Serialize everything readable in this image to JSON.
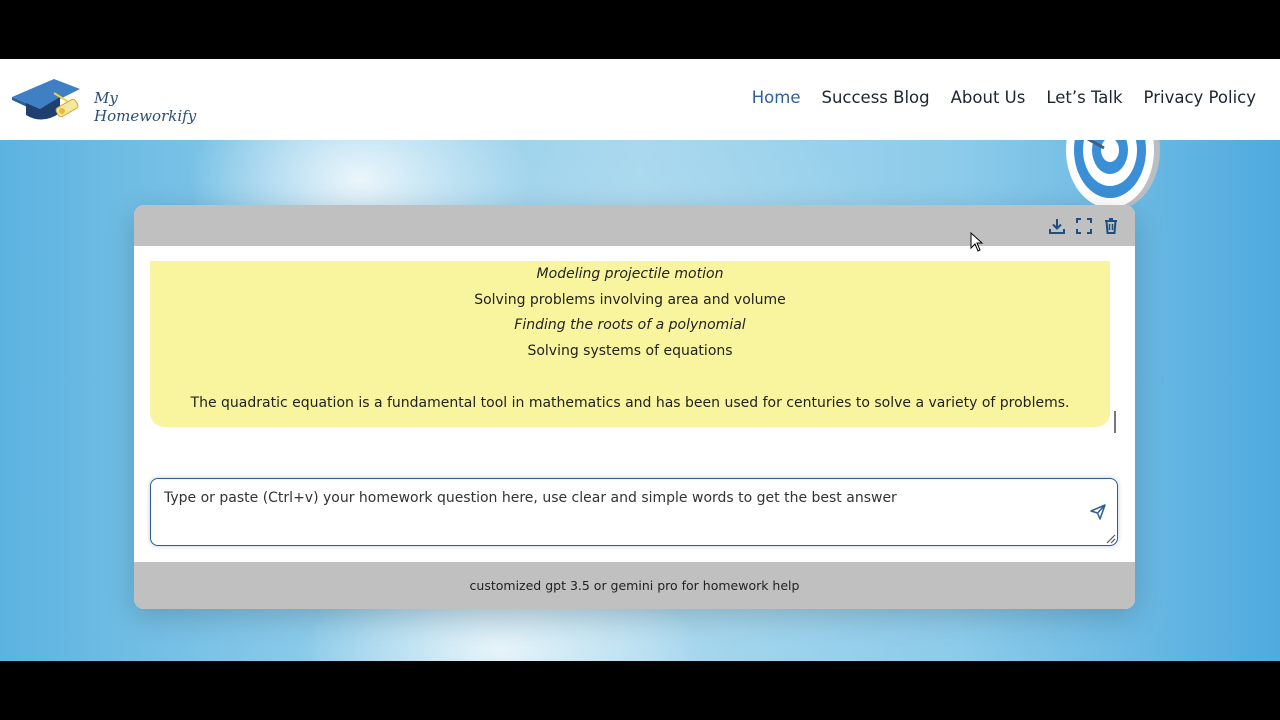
{
  "brand": {
    "name": "My Homeworkify",
    "colors": {
      "primary": "#2f5f9c",
      "bubble": "#f9f59e",
      "bar": "#c0c0c0"
    }
  },
  "nav": {
    "items": [
      {
        "label": "Home",
        "active": true
      },
      {
        "label": "Success Blog"
      },
      {
        "label": "About Us"
      },
      {
        "label": "Let’s Talk"
      },
      {
        "label": "Privacy Policy"
      }
    ]
  },
  "toolbar": {
    "icons": [
      "download-icon",
      "fullscreen-icon",
      "trash-icon"
    ]
  },
  "answer": {
    "lines": [
      "Modeling projectile motion",
      "Solving problems involving area and volume",
      "Finding the roots of a polynomial",
      "Solving systems of equations"
    ],
    "summary": "The quadratic equation is a fundamental tool in mathematics and has been used for centuries to solve a variety of problems."
  },
  "input": {
    "placeholder": "Type or paste (Ctrl+v) your homework question here, use clear and simple words to get the best answer",
    "value": ""
  },
  "footer": {
    "text": "customized gpt 3.5 or gemini pro for homework help"
  }
}
